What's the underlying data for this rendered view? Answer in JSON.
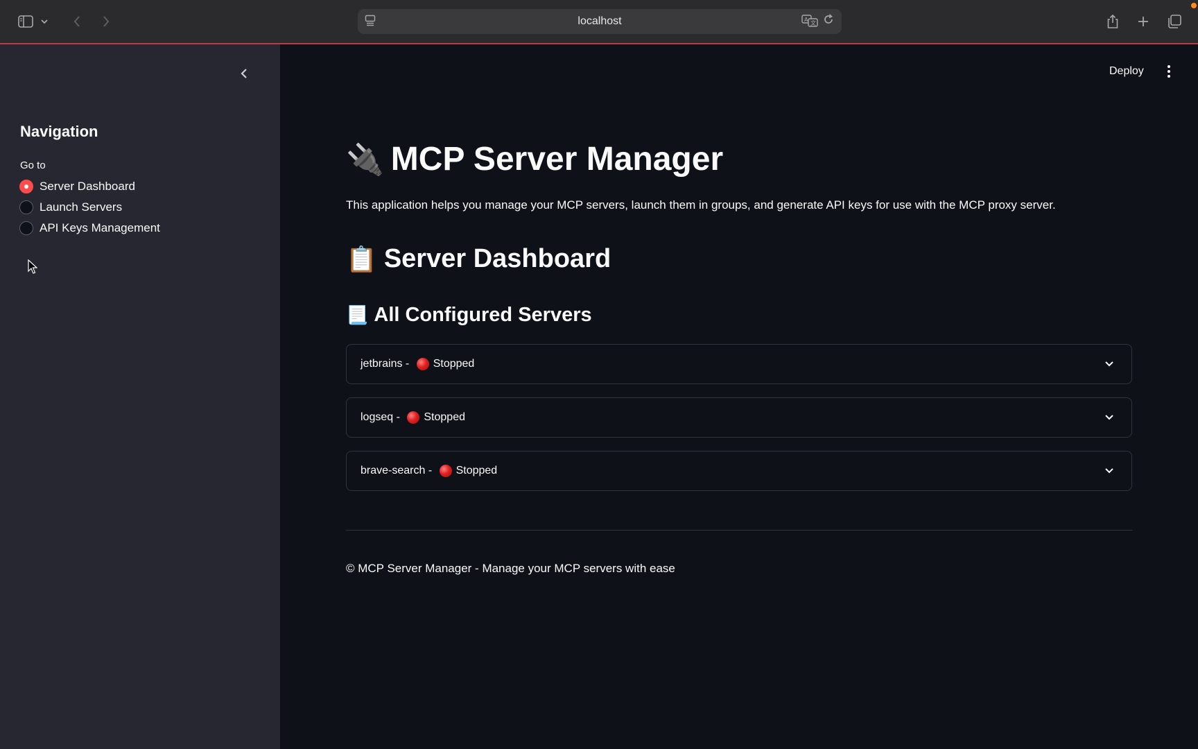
{
  "browser": {
    "url": "localhost",
    "icons": {
      "sidebar_toggle": "sidebar-icon",
      "tab_menu": "chevron-down-icon",
      "back": "arrow-left-icon",
      "forward": "arrow-right-icon",
      "share": "share-icon",
      "new_tab": "plus-icon",
      "tabs_overview": "tabs-icon",
      "translate": "translate-icon",
      "reload": "reload-icon"
    }
  },
  "sidebar": {
    "title": "Navigation",
    "radio_label": "Go to",
    "items": [
      {
        "label": "Server Dashboard",
        "selected": true
      },
      {
        "label": "Launch Servers",
        "selected": false
      },
      {
        "label": "API Keys Management",
        "selected": false
      }
    ]
  },
  "header": {
    "deploy_label": "Deploy"
  },
  "main": {
    "title_emoji": "🔌",
    "title": "MCP Server Manager",
    "intro": "This application helps you manage your MCP servers, launch them in groups, and generate API keys for use with the MCP proxy server.",
    "section_emoji": "📋",
    "section_title": "Server Dashboard",
    "subsection_emoji": "📃",
    "subsection_title": "All Configured Servers",
    "servers": [
      {
        "name": "jetbrains",
        "status": "Stopped"
      },
      {
        "name": "logseq",
        "status": "Stopped"
      },
      {
        "name": "brave-search",
        "status": "Stopped"
      }
    ],
    "separator": " - ",
    "footer": "© MCP Server Manager - Manage your MCP servers with ease"
  },
  "colors": {
    "accent": "#ff4b4b",
    "sidebar_bg": "#262730",
    "main_bg": "#0e1117",
    "status_stopped": "#e02020"
  }
}
